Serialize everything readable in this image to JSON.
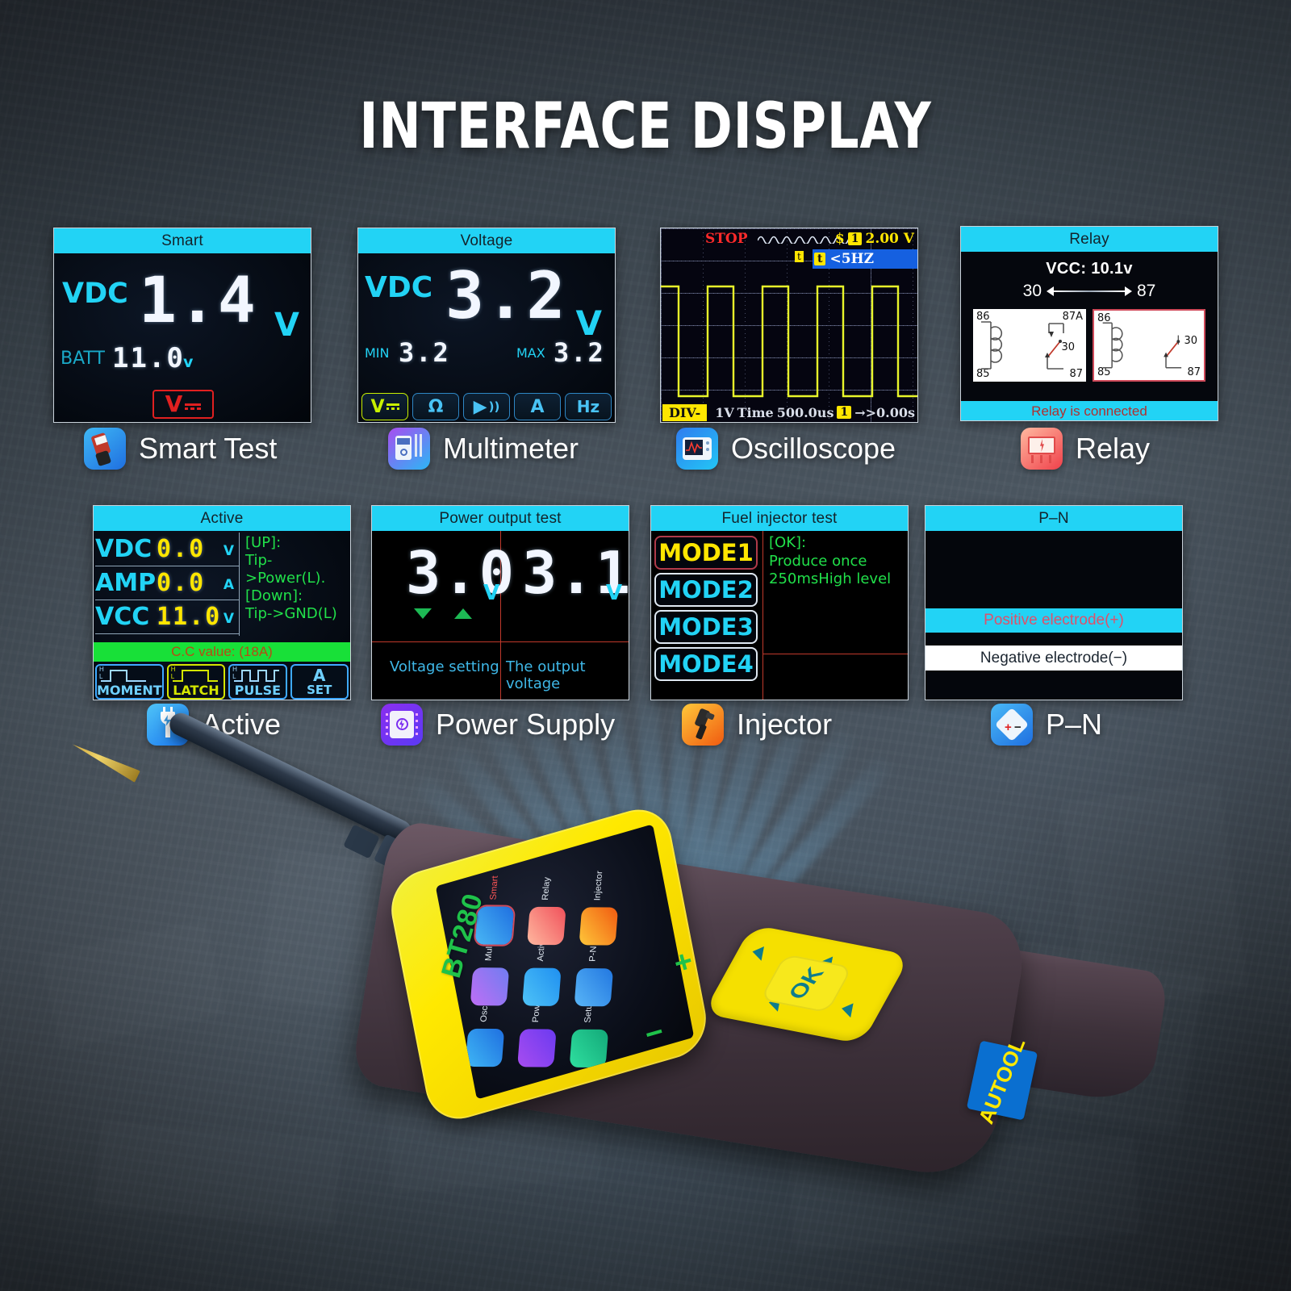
{
  "page": {
    "title": "INTERFACE DISPLAY"
  },
  "screens_row1": [
    {
      "id": "smart",
      "title": "Smart",
      "vdc_label": "VDC",
      "value": "1.4",
      "unit": "V",
      "batt_label": "BATT",
      "batt_value": "11.0",
      "batt_unit": "v",
      "mode_badge": "V",
      "caption": "Smart Test",
      "icon": "smart-tester-icon"
    },
    {
      "id": "voltage",
      "title": "Voltage",
      "vdc_label": "VDC",
      "value": "3.2",
      "unit": "V",
      "min_label": "MIN",
      "min_value": "3.2",
      "max_label": "MAX",
      "max_value": "3.2",
      "tabs": [
        "V",
        "Ω",
        "▶",
        "A",
        "Hz"
      ],
      "active_tab": 0,
      "caption": "Multimeter",
      "icon": "multimeter-icon"
    },
    {
      "id": "oscilloscope",
      "title": "",
      "status": "STOP",
      "channel_chip": "1",
      "volts_div": "2.00 V",
      "trigger_chip": "t",
      "trigger_label": "<5HZ",
      "div_label": "DIV-",
      "div_value": "1V",
      "time_label": "Time",
      "time_value": "500.0us",
      "offset_value": "→>0.00s",
      "caption": "Oscilloscope",
      "icon": "oscilloscope-icon"
    },
    {
      "id": "relay",
      "title": "Relay",
      "vcc": "VCC: 10.1v",
      "pin_left": "30",
      "pin_right": "87",
      "diagram1": {
        "tl": "86",
        "tr": "87A",
        "bl": "85",
        "br": "87",
        "mid": "30"
      },
      "diagram2": {
        "tl": "86",
        "tr": "",
        "bl": "85",
        "br": "87",
        "mid": "30"
      },
      "status": "Relay is connected",
      "caption": "Relay",
      "icon": "relay-icon"
    }
  ],
  "screens_row2": [
    {
      "id": "active",
      "title": "Active",
      "rows": [
        {
          "label": "VDC",
          "value": "0.0",
          "unit": "V"
        },
        {
          "label": "AMP",
          "value": "0.0",
          "unit": "A"
        },
        {
          "label": "VCC",
          "value": "11.0",
          "unit": "V"
        }
      ],
      "help": "[UP]:\nTip->Power(L).\n[Down]:\nTip->GND(L)",
      "cc_value": "C.C value: (18A)",
      "buttons": [
        "MOMENT",
        "LATCH",
        "PULSE",
        "A SET"
      ],
      "button_hi": "H",
      "button_lo": "L",
      "active_button": 1,
      "caption": "Active",
      "icon": "active-plug-icon"
    },
    {
      "id": "power_output",
      "title": "Power output test",
      "left_value": "3.0",
      "left_unit": "V",
      "left_caption": "Voltage setting",
      "right_value": "3.1",
      "right_unit": "V",
      "right_caption": "The output voltage",
      "caption": "Power Supply",
      "icon": "power-supply-icon"
    },
    {
      "id": "injector",
      "title": "Fuel injector test",
      "modes": [
        "MODE1",
        "MODE2",
        "MODE3",
        "MODE4"
      ],
      "selected_mode": 0,
      "info": "[OK]:\nProduce once\n250msHigh level",
      "caption": "Injector",
      "icon": "injector-icon"
    },
    {
      "id": "pn",
      "title": "P–N",
      "positive": "Positive electrode(+)",
      "negative": "Negative electrode(−)",
      "caption": "P–N",
      "icon": "polarity-icon"
    }
  ],
  "device": {
    "brand": "BT280",
    "ok_button": "OK",
    "plus_button": "+",
    "minus_button": "−",
    "logo": "AUTOOL",
    "menu": [
      {
        "label": "Oscilloscope",
        "color": "#3fa9f5"
      },
      {
        "label": "Powered by",
        "color": "#a14df0"
      },
      {
        "label": "Setup",
        "color": "#21c98a"
      },
      {
        "label": "Multimeter",
        "color": "#b65ef0"
      },
      {
        "label": "Active",
        "color": "#3fb8f5"
      },
      {
        "label": "P-N",
        "color": "#4aa8f5"
      },
      {
        "label": "Smart",
        "color": "#3fb8f5"
      },
      {
        "label": "Relay",
        "color": "#f08080"
      },
      {
        "label": "Injector",
        "color": "#f59a20"
      }
    ]
  },
  "colors": {
    "header_cyan": "#22d3f5",
    "lcd_black": "#05070d",
    "green": "#21e04a",
    "yellow": "#ffe600",
    "red": "#e02020",
    "device_yellow": "#ffe900"
  }
}
